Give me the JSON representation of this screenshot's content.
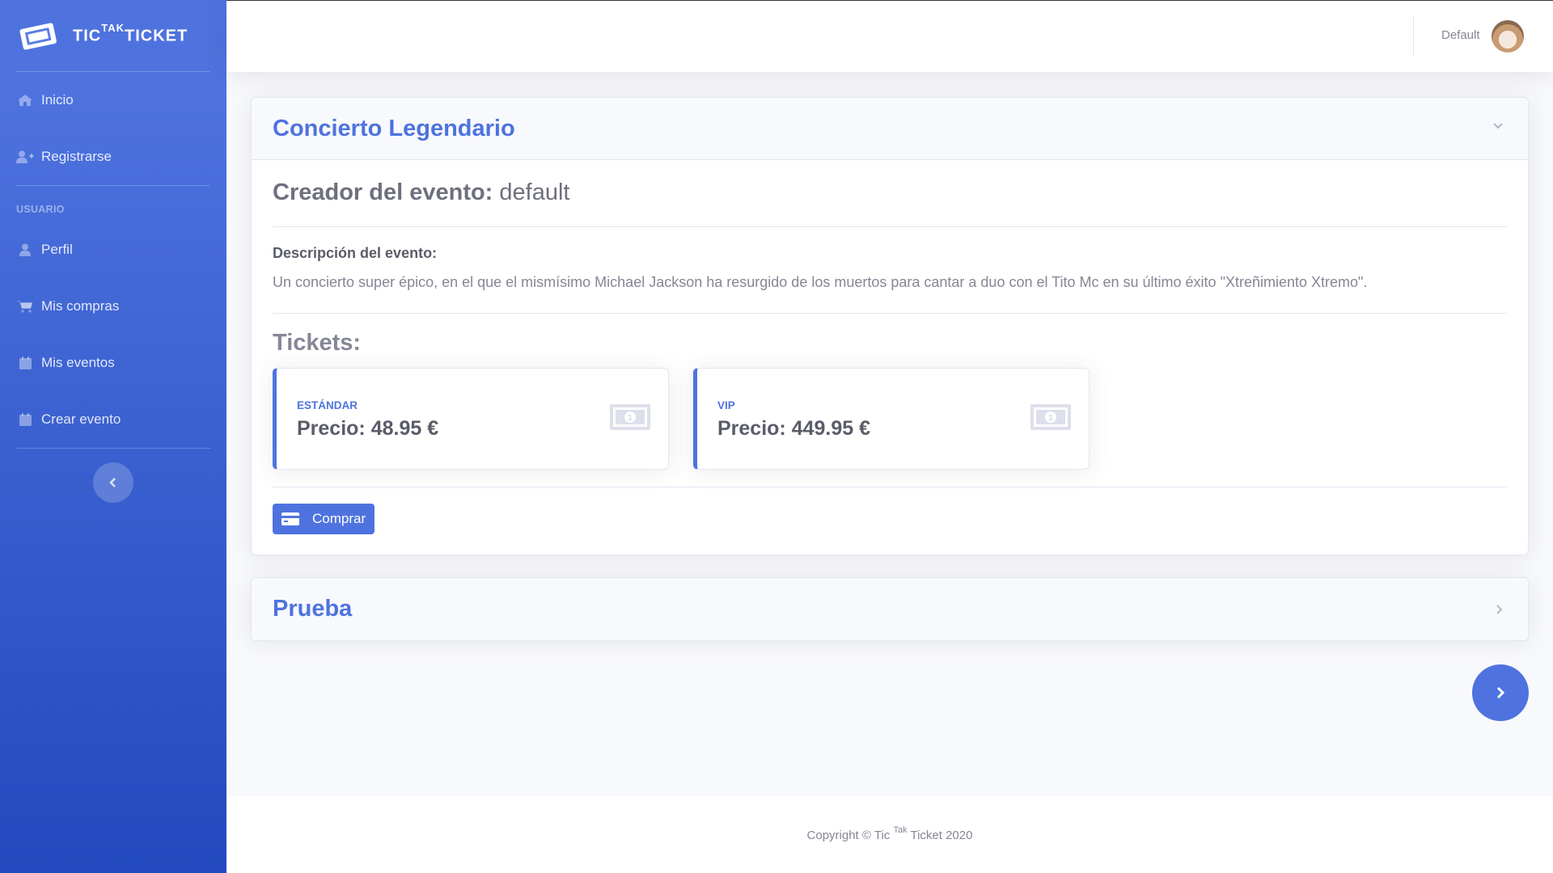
{
  "brand": {
    "part1": "Tic",
    "part2": "Tak",
    "part3": "Ticket",
    "icon": "ticket-icon"
  },
  "sidebar": {
    "items_top": [
      {
        "label": "Inicio",
        "icon": "home-icon"
      },
      {
        "label": "Registrarse",
        "icon": "user-plus-icon"
      }
    ],
    "heading": "Usuario",
    "items_user": [
      {
        "label": "Perfil",
        "icon": "user-icon"
      },
      {
        "label": "Mis compras",
        "icon": "shopping-cart-icon"
      },
      {
        "label": "Mis eventos",
        "icon": "calendar-check-icon"
      },
      {
        "label": "Crear evento",
        "icon": "calendar-plus-icon"
      }
    ],
    "toggle_icon": "chevron-left-icon"
  },
  "topbar": {
    "user_name": "Default",
    "avatar_icon": "avatar"
  },
  "events": [
    {
      "title": "Concierto Legendario",
      "expanded": true,
      "creator_label": "Creador del evento:",
      "creator_value": "default",
      "description_label": "Descripción del evento:",
      "description": "Un concierto super épico, en el que el mismísimo Michael Jackson ha resurgido de los muertos para cantar a duo con el Tito Mc en su último éxito \"Xtreñimiento Xtremo\".",
      "tickets_label": "Tickets:",
      "tickets": [
        {
          "type": "Estándar",
          "price": "Precio: 48.95 €"
        },
        {
          "type": "VIP",
          "price": "Precio: 449.95 €"
        }
      ],
      "buy_label": "Comprar"
    },
    {
      "title": "Prueba",
      "expanded": false
    }
  ],
  "footer": {
    "text_pre": "Copyright © Tic ",
    "sup": "Tak",
    "text_post": " Ticket 2020"
  },
  "colors": {
    "primary": "#4e73df",
    "sidebar_end": "#224abe",
    "text": "#858796"
  }
}
